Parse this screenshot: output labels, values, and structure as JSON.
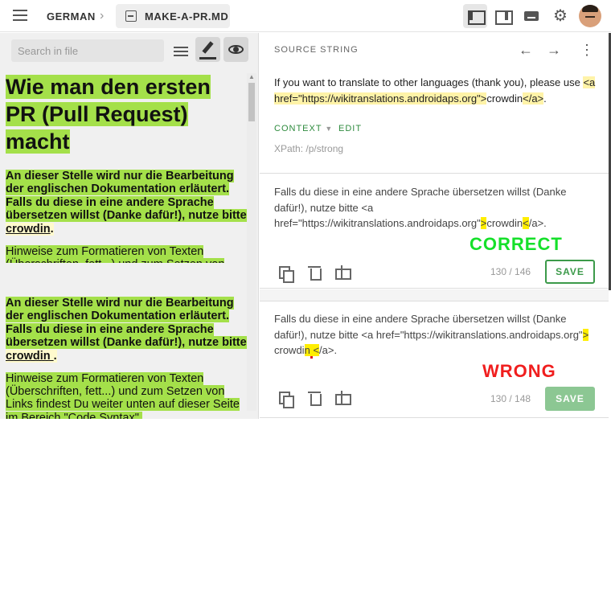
{
  "topbar": {
    "project": "GERMAN",
    "file": "MAKE-A-PR.MD"
  },
  "preview": {
    "search_placeholder": "Search in file",
    "heading": "Wie man den ersten PR (Pull Request) macht",
    "bold_para_pre": "An dieser Stelle wird nur die Bearbeitung der englischen Dokumentation erläutert. Falls du diese in eine andere Sprache übersetzen willst (Danke dafür!), nutze bitte ",
    "link": "crowdin",
    "link_spaced": "crowdin ",
    "period": ".",
    "hint_para": "Hinweise zum Formatieren von Texten (Überschriften, fett...) und zum Setzen von Links findest Du weiter unten auf dieser Seite im Bereich \"Code Syntax\"."
  },
  "source": {
    "header": "SOURCE STRING",
    "text_before": "If you want to translate to other languages (thank you), please use ",
    "tag_open": "<a href=\"https://wikitranslations.androidaps.org\">",
    "link_text": "crowdin",
    "tag_close": "</a>",
    "period": ".",
    "context_tab": "CONTEXT",
    "edit_tab": "EDIT",
    "xpath": "XPath: /p/strong"
  },
  "translations": [
    {
      "text_start": "Falls du diese in eine andere Sprache übersetzen willst (Danke dafür!), nutze bitte <a href=\"https://wikitranslations.androidaps.org\"",
      "gt": ">",
      "c": "c",
      "rowdi": "rowdi",
      "n": "n",
      "lt": "<",
      "end": "/a>.",
      "verdict": "CORRECT",
      "counter": "130 / 146",
      "save": "SAVE"
    },
    {
      "text_start": "Falls du diese in eine andere Sprache übersetzen willst (Danke dafür!), nutze bitte <a href=\"https://wikitranslations.androidaps.org\"",
      "gt": ">",
      "space1": " ",
      "c": "c",
      "rowdi": "rowdi",
      "n": "n",
      "space2": " ",
      "lt": "<",
      "end": "/a>.",
      "verdict": "WRONG",
      "counter": "130 / 148",
      "save": "SAVE"
    }
  ]
}
